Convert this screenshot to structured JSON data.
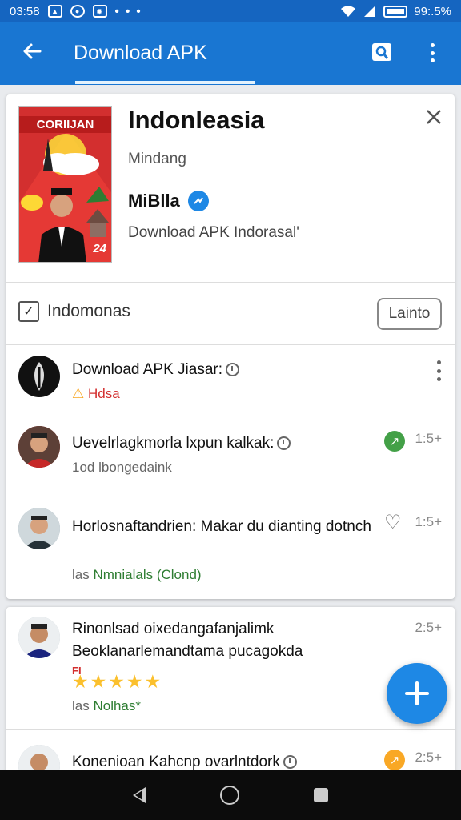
{
  "status_bar": {
    "time": "03:58",
    "dots": "• • •",
    "battery_text": "99:.5%"
  },
  "app_bar": {
    "title": "Download APK"
  },
  "app_card": {
    "cover_title": "CORIIJAN",
    "cover_number": "24",
    "name": "Indonleasia",
    "developer": "Mindang",
    "publisher": "MiBlla",
    "description": "Download APK Indorasal'"
  },
  "options": {
    "checkbox_label": "Indomonas",
    "launch_label": "Lainto"
  },
  "list": [
    {
      "title": "Download APK Jiasar:",
      "sub": "Hdsa",
      "sub_color": "#d32f2f"
    },
    {
      "title": "Uevelrlagkmorla lxpun kalkak:",
      "sub": "1od lbongedaink",
      "time": "1:5+"
    },
    {
      "title": "Horlosnaftandrien: Makar du dianting dotnch",
      "sub_prefix": "las",
      "sub": "Nmnialals (Clond)",
      "sub_color": "#2e7d32",
      "time": "1:5+"
    }
  ],
  "list2": [
    {
      "title": "Rinonlsad oixedangafanjalimk Beoklanarlemandtama pucagokda",
      "flag": "FI",
      "stars": "★★★★★",
      "sub_prefix": "las",
      "sub": "Nolhas*",
      "sub_color": "#2e7d32",
      "time": "2:5+"
    },
    {
      "title": "Konenioan Kahcnp ovarlntdork",
      "time": "2:5+"
    }
  ],
  "colors": {
    "app_bar": "#1976d2",
    "status_bar": "#1565c0",
    "fab": "#1e88e5",
    "verified": "#1e88e5"
  },
  "icons": [
    "back-arrow-icon",
    "search-icon",
    "more-vert-icon",
    "close-icon",
    "verified-icon",
    "clock-icon",
    "heart-icon",
    "add-icon"
  ]
}
